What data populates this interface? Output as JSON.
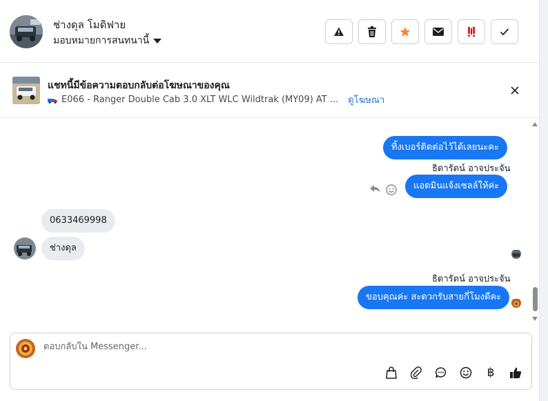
{
  "header": {
    "contact_name": "ช่างดุล โมดิฟาย",
    "assign_label": "มอบหมายการสนทนานี้",
    "actions": [
      "warning-icon",
      "trash-icon",
      "star-icon",
      "envelope-icon",
      "spam-icon",
      "check-icon"
    ]
  },
  "ad": {
    "title": "แชทนี้มีข้อความตอบกลับต่อโฆษณาของคุณ",
    "ad_text": "E066 - Ranger Double Cab 3.0 XLT WLC Wildtrak (MY09) AT ...",
    "view_link": "ดูโฆษณา"
  },
  "messages": {
    "m1": "ทิ้งเบอร์ติดต่อไว้ได้เลยนะคะ",
    "sender1": "ธิดารัตน์ อาจประจัน",
    "m2": "แอดมินแจ้งเซลล์ให้ค่ะ",
    "m3": "0633469998",
    "m4": "ช่างดุล",
    "sender2": "ธิดารัตน์ อาจประจัน",
    "m5": "ขอบคุณค่ะ สะดวกรับสายกี่โมงดีคะ"
  },
  "composer": {
    "placeholder": "ตอบกลับใน Messenger...",
    "tools": [
      "shopping-bag-icon",
      "paperclip-icon",
      "chat-bubble-icon",
      "emoji-icon",
      "baht-icon",
      "thumbs-up-icon"
    ],
    "baht_symbol": "฿"
  },
  "colors": {
    "outgoing_bubble": "#1877f2",
    "incoming_bubble": "#e9ebee",
    "link": "#216fdb",
    "star": "#f5862e",
    "spam": "#e02020"
  }
}
